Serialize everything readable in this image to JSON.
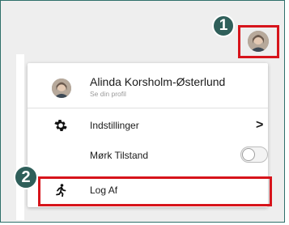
{
  "callouts": [
    "1",
    "2"
  ],
  "menu": {
    "profile": {
      "name": "Alinda Korsholm-Østerlund",
      "subtitle": "Se din profil"
    },
    "settings": {
      "label": "Indstillinger",
      "icon": "gear-icon",
      "chevron": ">"
    },
    "dark_mode": {
      "label": "Mørk Tilstand",
      "icon": "moon-icon",
      "enabled": false
    },
    "logout": {
      "label": "Log Af",
      "icon": "running-person-icon"
    }
  },
  "colors": {
    "highlight": "#d7141b",
    "badge": "#2f5f5a",
    "frame": "#2f6f6a"
  }
}
